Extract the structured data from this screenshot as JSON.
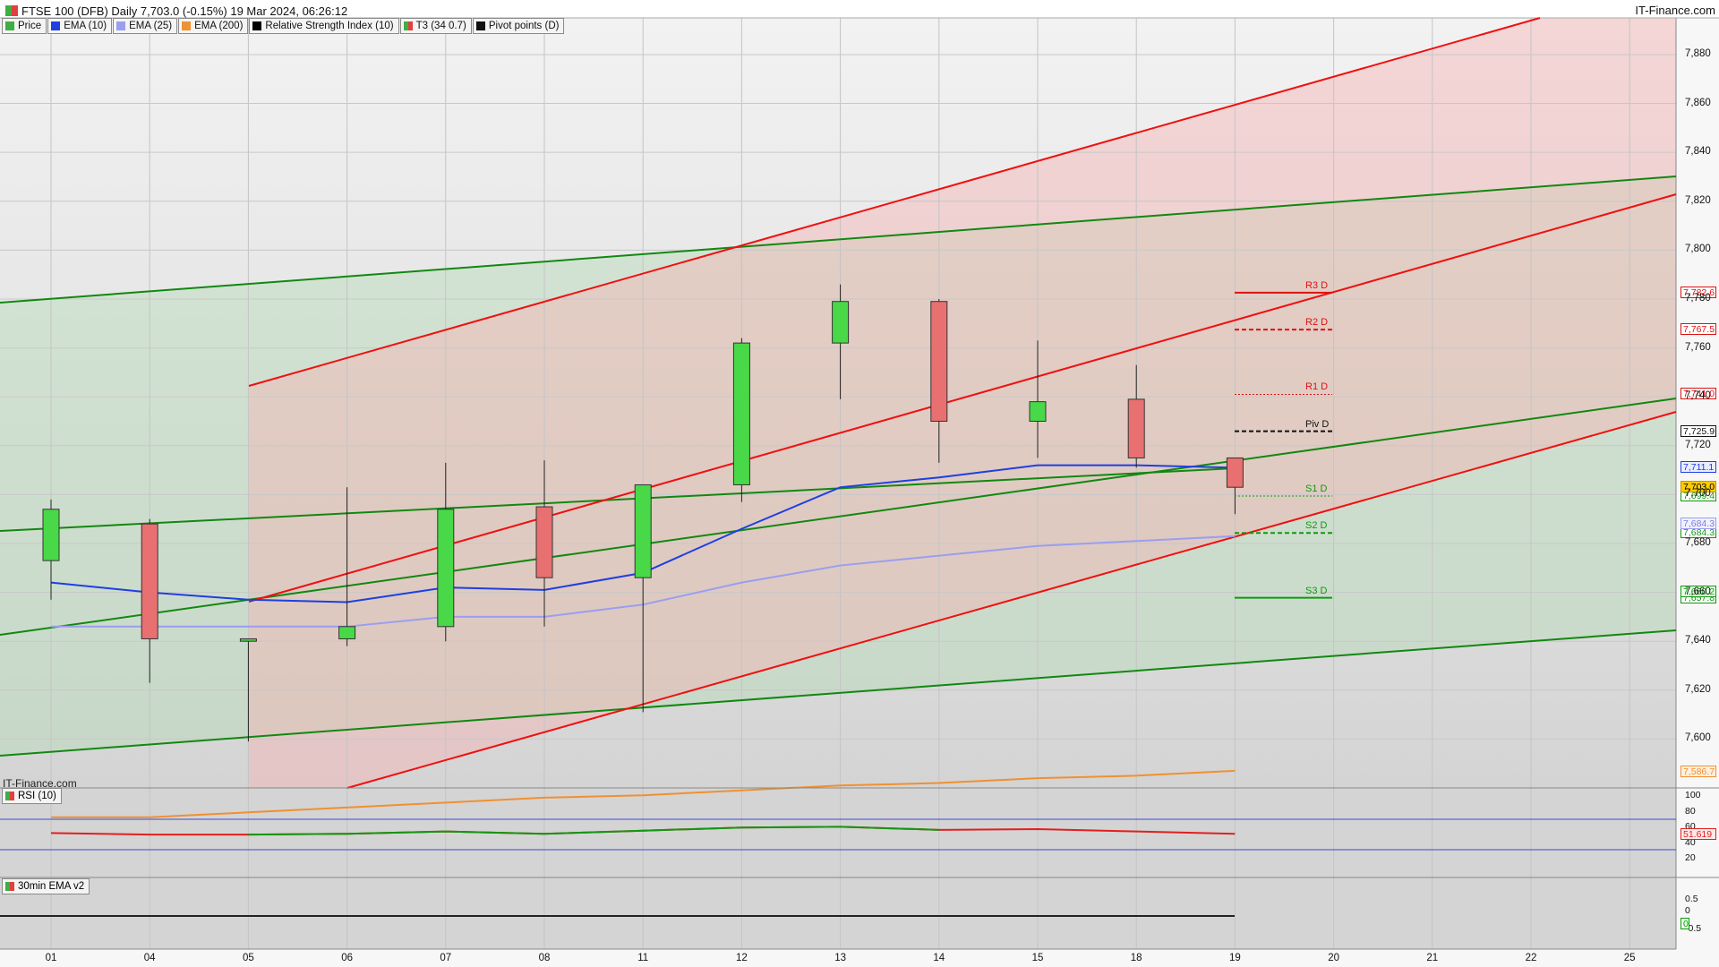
{
  "header": {
    "title": "FTSE 100 (DFB) Daily 7,703.0 (-0.15%) 19 Mar 2024, 06:26:12",
    "brand": "IT-Finance.com"
  },
  "legend": [
    {
      "label": "Price",
      "color": "#3cb043",
      "icon": "candle-icon"
    },
    {
      "label": "EMA (10)",
      "color": "#1f3fe0",
      "icon": "line-icon"
    },
    {
      "label": "EMA (25)",
      "color": "#9a9ef0",
      "icon": "line-icon"
    },
    {
      "label": "EMA (200)",
      "color": "#f09030",
      "icon": "line-icon"
    },
    {
      "label": "Relative Strength Index (10)",
      "color": "#000000",
      "icon": "rsi-icon"
    },
    {
      "label": "T3 (34 0.7)",
      "color": "#3cb043",
      "icon": "t3-icon"
    },
    {
      "label": "Pivot points (D)",
      "color": "#111111",
      "icon": "pivot-icon"
    }
  ],
  "watermark": "IT-Finance.com",
  "rsi_pane": {
    "label": "RSI (10)",
    "current": "51.619",
    "ticks": [
      "100",
      "80",
      "60",
      "40",
      "20"
    ]
  },
  "ema_pane": {
    "label": "30min EMA v2",
    "ticks": [
      "0.5",
      "0",
      "-0.5"
    ],
    "zero_badge": "0"
  },
  "colors": {
    "up": "#48d848",
    "down": "#e87070",
    "ema10": "#1f3fe0",
    "ema25": "#9a9ef0",
    "ema200": "#f09030",
    "channel_red": "#ee1111",
    "channel_green": "#118811"
  },
  "chart_data": {
    "type": "candlestick",
    "categories": [
      "01",
      "04",
      "05",
      "06",
      "07",
      "08",
      "11",
      "12",
      "13",
      "14",
      "15",
      "18",
      "19"
    ],
    "future_categories": [
      "20",
      "21",
      "22",
      "25"
    ],
    "ylim": [
      7580,
      7895
    ],
    "y_ticks": [
      "7,880",
      "7,860",
      "7,840",
      "7,820",
      "7,800",
      "7,780",
      "7,760",
      "7,740",
      "7,720",
      "7,700",
      "7,680",
      "7,660",
      "7,640",
      "7,620",
      "7,600"
    ],
    "ohlc": [
      {
        "o": 7673,
        "h": 7698,
        "l": 7657,
        "c": 7694
      },
      {
        "o": 7688,
        "h": 7690,
        "l": 7623,
        "c": 7641
      },
      {
        "o": 7640,
        "h": 7641,
        "l": 7599,
        "c": 7641
      },
      {
        "o": 7641,
        "h": 7703,
        "l": 7638,
        "c": 7646
      },
      {
        "o": 7646,
        "h": 7713,
        "l": 7640,
        "c": 7694
      },
      {
        "o": 7695,
        "h": 7714,
        "l": 7646,
        "c": 7666
      },
      {
        "o": 7666,
        "h": 7704,
        "l": 7611,
        "c": 7704
      },
      {
        "o": 7704,
        "h": 7764,
        "l": 7697,
        "c": 7762
      },
      {
        "o": 7762,
        "h": 7786,
        "l": 7739,
        "c": 7779
      },
      {
        "o": 7779,
        "h": 7780,
        "l": 7713,
        "c": 7730
      },
      {
        "o": 7730,
        "h": 7763,
        "l": 7715,
        "c": 7738
      },
      {
        "o": 7739,
        "h": 7753,
        "l": 7711,
        "c": 7715
      },
      {
        "o": 7715,
        "h": 7715,
        "l": 7692,
        "c": 7703
      }
    ],
    "ema10": [
      7664,
      7660,
      7657,
      7656,
      7662,
      7661,
      7668,
      7686,
      7703,
      7707,
      7712,
      7712,
      7711
    ],
    "ema25": [
      7646,
      7646,
      7646,
      7646,
      7650,
      7650,
      7655,
      7664,
      7671,
      7675,
      7679,
      7681,
      7683
    ],
    "ema200": [
      7568,
      7568,
      7570,
      7572,
      7574,
      7576,
      7577,
      7579,
      7581,
      7582,
      7584,
      7585,
      7587
    ],
    "pivots": [
      {
        "label": "R3 D",
        "value": 7782.6,
        "badge": "7,782.6",
        "color": "#dd1111",
        "style": "solid"
      },
      {
        "label": "R2 D",
        "value": 7767.5,
        "badge": "7,767.5",
        "color": "#dd1111",
        "style": "dashed"
      },
      {
        "label": "R1 D",
        "value": 7741.0,
        "badge": "7,741.0",
        "color": "#dd1111",
        "style": "dotted"
      },
      {
        "label": "Piv D",
        "value": 7725.9,
        "badge": "7,725.9",
        "color": "#111111",
        "style": "dashed"
      },
      {
        "label": "S1 D",
        "value": 7699.4,
        "badge": "7,699.4",
        "color": "#119911",
        "style": "dotted"
      },
      {
        "label": "S2 D",
        "value": 7684.3,
        "badge": "7,684.3",
        "color": "#119911",
        "style": "dashed"
      },
      {
        "label": "S3 D",
        "value": 7657.8,
        "badge": "7,657.8",
        "color": "#119911",
        "style": "solid"
      }
    ],
    "badges": {
      "ema10": "7,711.1",
      "price": "7,703.0",
      "ema25": "7,684.3",
      "t3": "7,660.2",
      "ema200": "7,586.7"
    },
    "rsi": [
      53,
      51,
      51,
      52,
      55,
      52,
      56,
      60,
      61,
      57,
      58,
      55,
      52
    ]
  }
}
